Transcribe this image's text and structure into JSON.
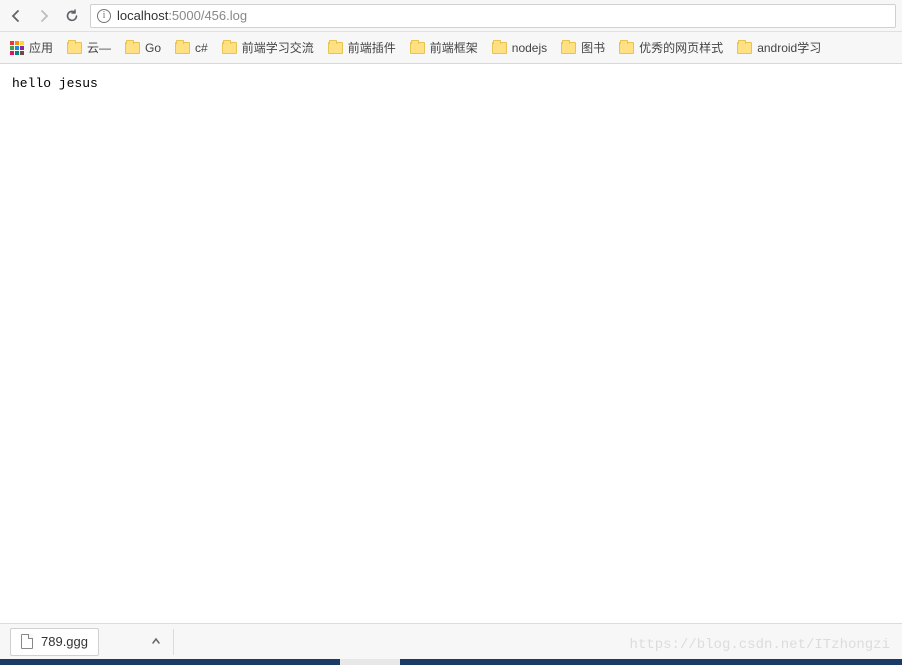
{
  "nav": {
    "url_host": "localhost",
    "url_port_path": ":5000/456.log"
  },
  "bookmarks": {
    "apps_label": "应用",
    "items": [
      {
        "label": "云—"
      },
      {
        "label": "Go"
      },
      {
        "label": "c#"
      },
      {
        "label": "前端学习交流"
      },
      {
        "label": "前端插件"
      },
      {
        "label": "前端框架"
      },
      {
        "label": "nodejs"
      },
      {
        "label": "图书"
      },
      {
        "label": "优秀的网页样式"
      },
      {
        "label": "android学习"
      }
    ]
  },
  "page": {
    "body_text": "hello jesus"
  },
  "downloads": {
    "filename": "789.ggg"
  },
  "watermark": "https://blog.csdn.net/ITzhongzi"
}
